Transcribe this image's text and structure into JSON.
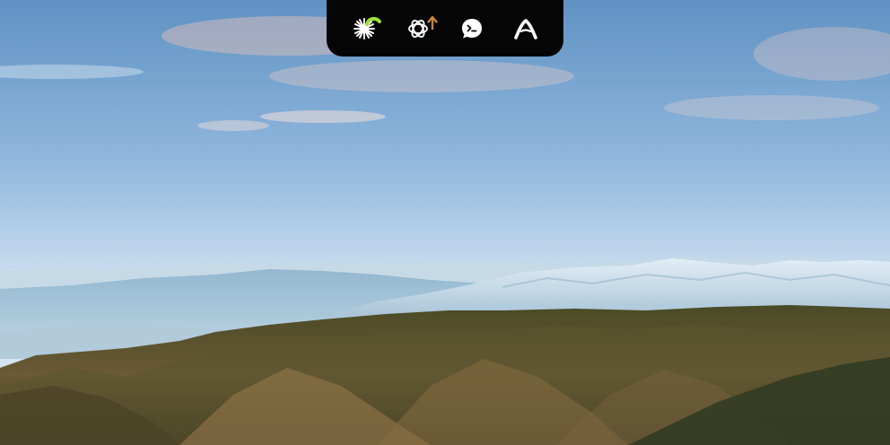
{
  "desktop": {
    "wallpaper": "mountain-ridge-landscape",
    "sky_color_top": "#5f93c4",
    "sky_color_horizon": "#d4e5f0",
    "mountain_color_near": "#51502a",
    "mountain_color_far": "#b6cbd8"
  },
  "notch_bar": {
    "background": "#050505",
    "apps": [
      {
        "name": "claude-app",
        "icon": "starburst-icon",
        "badge": "activity-indicator",
        "badge_color": "#9be23a"
      },
      {
        "name": "chatgpt-app",
        "icon": "openai-knot-icon",
        "badge": "update-arrow",
        "badge_color": "#c7843a"
      },
      {
        "name": "terminal-chat-app",
        "icon": "chat-prompt-icon"
      },
      {
        "name": "arc-app",
        "icon": "peak-a-icon"
      }
    ]
  }
}
